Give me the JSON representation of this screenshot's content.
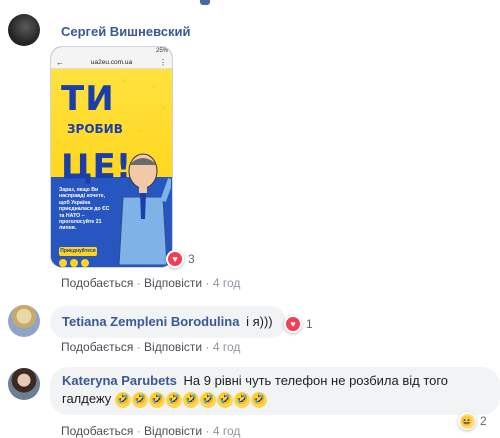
{
  "colors": {
    "link_blue": "#385898",
    "bubble_bg": "#f2f3f5",
    "heart": "#f33e58",
    "muted": "#90949c"
  },
  "comments": [
    {
      "author": "Сергей Вишневский",
      "avatar_icon": "user-avatar",
      "attachment": {
        "status_bar": "25%",
        "url": "ua2eu.com.ua",
        "headline_1": "ТИ",
        "headline_2": "ЗРОБИВ",
        "headline_3": "ЦЕ!",
        "body": "Зараз, якщо Ви насправді хочете, щоб Україна приєдналася до ЄС та НАТО – проголосуйте 21 липня.",
        "button": "Приєднуйтеся"
      },
      "reaction_icon": "heart-icon",
      "reaction_count": "3",
      "like_label": "Подобається",
      "reply_label": "Відповісти",
      "time": "4 год"
    },
    {
      "author": "Tetiana Zempleni Borodulina",
      "text": "і я)))",
      "avatar_icon": "user-avatar",
      "reaction_icon": "heart-icon",
      "reaction_count": "1",
      "like_label": "Подобається",
      "reply_label": "Відповісти",
      "time": "4 год"
    },
    {
      "author": "Kateryna Parubets",
      "text": "На 9 рівні чуть телефон не розбила від того галдежу",
      "emoji_count": 9,
      "emoji_icon": "rofl-emoji",
      "avatar_icon": "user-avatar",
      "reaction_icon": "haha-icon",
      "reaction_count": "2",
      "like_label": "Подобається",
      "reply_label": "Відповісти",
      "time": "4 год"
    }
  ],
  "separator": "·"
}
